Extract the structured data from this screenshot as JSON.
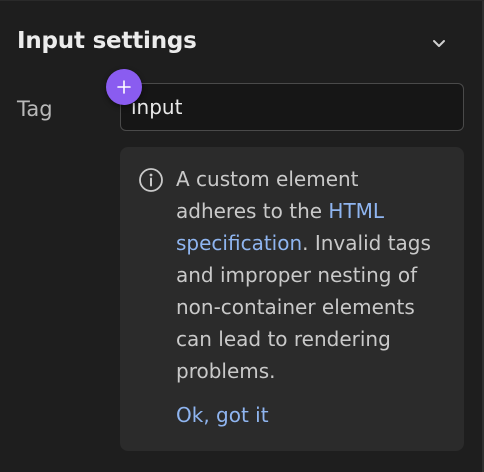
{
  "header": {
    "title": "Input settings",
    "collapse_icon": "chevron-down-icon"
  },
  "tag_field": {
    "label": "Tag",
    "value": "input"
  },
  "add_button": {
    "icon": "plus-icon",
    "color": "#8a5cf0"
  },
  "info_box": {
    "icon": "info-icon",
    "text_before_link": "A custom element adheres to the ",
    "link_text": "HTML specification",
    "text_after_link": ". Invalid tags and improper nesting of non-container elements can lead to rendering problems.",
    "dismiss_label": "Ok, got it"
  },
  "colors": {
    "background": "#1e1e1e",
    "accent": "#8a5cf0",
    "link": "#8fb5f0"
  }
}
